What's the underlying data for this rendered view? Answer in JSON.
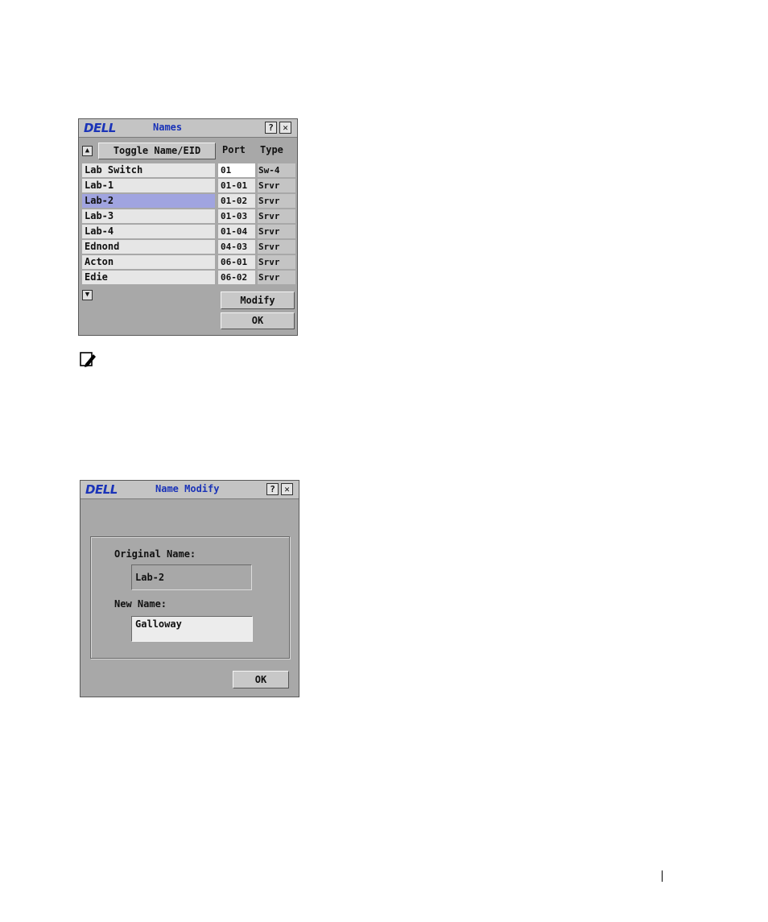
{
  "names_window": {
    "logo": "DELL",
    "title": "Names",
    "help_label": "?",
    "close_label": "✕",
    "scroll_up_label": "▲",
    "scroll_down_label": "▼",
    "toggle_button": "Toggle Name/EID",
    "column_port": "Port",
    "column_type": "Type",
    "rows": [
      {
        "name": "Lab Switch",
        "port": "01",
        "type": "Sw-4"
      },
      {
        "name": "Lab-1",
        "port": "01-01",
        "type": "Srvr"
      },
      {
        "name": "Lab-2",
        "port": "01-02",
        "type": "Srvr"
      },
      {
        "name": "Lab-3",
        "port": "01-03",
        "type": "Srvr"
      },
      {
        "name": "Lab-4",
        "port": "01-04",
        "type": "Srvr"
      },
      {
        "name": "Ednond",
        "port": "04-03",
        "type": "Srvr"
      },
      {
        "name": "Acton",
        "port": "06-01",
        "type": "Srvr"
      },
      {
        "name": "Edie",
        "port": "06-02",
        "type": "Srvr"
      }
    ],
    "modify_button": "Modify",
    "ok_button": "OK"
  },
  "modify_window": {
    "logo": "DELL",
    "title": "Name Modify",
    "help_label": "?",
    "close_label": "✕",
    "original_name_label": "Original Name:",
    "original_name_value": "Lab-2",
    "new_name_label": "New Name:",
    "new_name_value": "Galloway",
    "ok_button": "OK"
  },
  "colors": {
    "title_text": "#1a33b8",
    "selection": "#a0a4e0",
    "window_bg": "#a8a8a8"
  }
}
